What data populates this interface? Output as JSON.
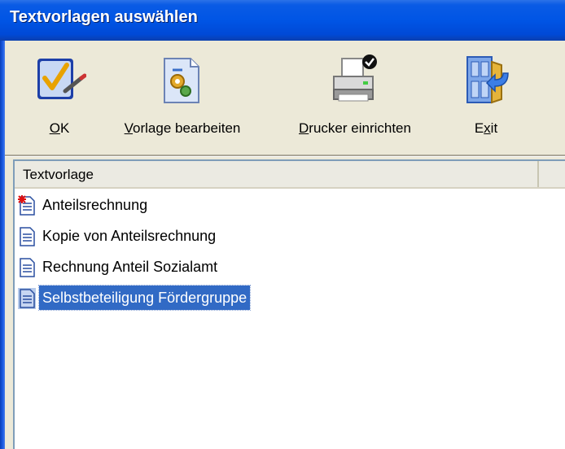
{
  "window": {
    "title": "Textvorlagen auswählen"
  },
  "toolbar": {
    "buttons": [
      {
        "label": "OK",
        "mnemonic": "O",
        "rest": "K",
        "icon": "ok-check-icon"
      },
      {
        "label": "Vorlage bearbeiten",
        "mnemonic": "V",
        "rest": "orlage bearbeiten",
        "icon": "edit-template-icon"
      },
      {
        "label": "Drucker einrichten",
        "mnemonic": "D",
        "rest": "rucker einrichten",
        "icon": "printer-icon"
      },
      {
        "label": "Exit",
        "pre": "E",
        "mnemonic": "x",
        "rest": "it",
        "icon": "exit-door-icon"
      }
    ]
  },
  "list": {
    "columns": [
      "Textvorlage",
      ""
    ],
    "items": [
      {
        "label": "Anteilsrechnung",
        "icon": "document-new-icon",
        "selected": false
      },
      {
        "label": "Kopie von Anteilsrechnung",
        "icon": "document-icon",
        "selected": false
      },
      {
        "label": "Rechnung Anteil Sozialamt",
        "icon": "document-icon",
        "selected": false
      },
      {
        "label": "Selbstbeteiligung Fördergruppe",
        "icon": "document-icon",
        "selected": true
      }
    ]
  },
  "colors": {
    "titlebar": "#0055E5",
    "selection": "#316AC5",
    "face": "#ECE9D8"
  }
}
